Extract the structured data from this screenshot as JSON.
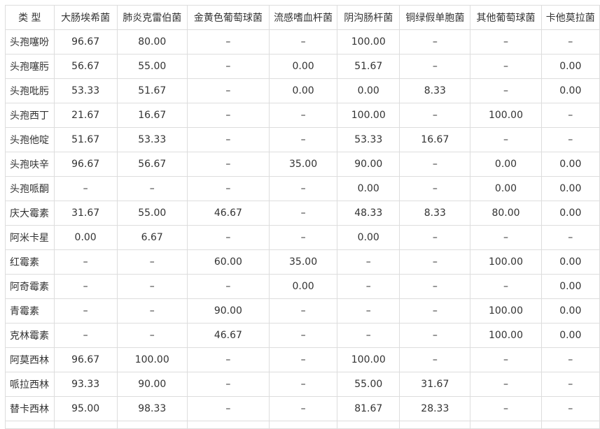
{
  "table": {
    "headers": [
      "类 型",
      "大肠埃希菌",
      "肺炎克雷伯菌",
      "金黄色葡萄球菌",
      "流感嗜血杆菌",
      "阴沟肠杆菌",
      "铜绿假单胞菌",
      "其他葡萄球菌",
      "卡他莫拉菌"
    ],
    "rows": [
      [
        "头孢噻吩",
        "96.67",
        "80.00",
        "–",
        "–",
        "100.00",
        "–",
        "–",
        "–"
      ],
      [
        "头孢噻肟",
        "56.67",
        "55.00",
        "–",
        "0.00",
        "51.67",
        "–",
        "–",
        "0.00"
      ],
      [
        "头孢吡肟",
        "53.33",
        "51.67",
        "–",
        "0.00",
        "0.00",
        "8.33",
        "–",
        "0.00"
      ],
      [
        "头孢西丁",
        "21.67",
        "16.67",
        "–",
        "–",
        "100.00",
        "–",
        "100.00",
        "–"
      ],
      [
        "头孢他啶",
        "51.67",
        "53.33",
        "–",
        "–",
        "53.33",
        "16.67",
        "–",
        "–"
      ],
      [
        "头孢呋辛",
        "96.67",
        "56.67",
        "–",
        "35.00",
        "90.00",
        "–",
        "0.00",
        "0.00"
      ],
      [
        "头孢哌酮",
        "–",
        "–",
        "–",
        "–",
        "0.00",
        "–",
        "0.00",
        "0.00"
      ],
      [
        "庆大霉素",
        "31.67",
        "55.00",
        "46.67",
        "–",
        "48.33",
        "8.33",
        "80.00",
        "0.00"
      ],
      [
        "阿米卡星",
        "0.00",
        "6.67",
        "–",
        "–",
        "0.00",
        "–",
        "–",
        "–"
      ],
      [
        "红霉素",
        "–",
        "–",
        "60.00",
        "35.00",
        "–",
        "–",
        "100.00",
        "0.00"
      ],
      [
        "阿奇霉素",
        "–",
        "–",
        "–",
        "0.00",
        "–",
        "–",
        "–",
        "0.00"
      ],
      [
        "青霉素",
        "–",
        "–",
        "90.00",
        "–",
        "–",
        "–",
        "100.00",
        "0.00"
      ],
      [
        "克林霉素",
        "–",
        "–",
        "46.67",
        "–",
        "–",
        "–",
        "100.00",
        "0.00"
      ],
      [
        "阿莫西林",
        "96.67",
        "100.00",
        "–",
        "–",
        "100.00",
        "–",
        "–",
        "–"
      ],
      [
        "哌拉西林",
        "93.33",
        "90.00",
        "–",
        "–",
        "55.00",
        "31.67",
        "–",
        "–"
      ],
      [
        "替卡西林",
        "95.00",
        "98.33",
        "–",
        "–",
        "81.67",
        "28.33",
        "–",
        "–"
      ]
    ]
  }
}
